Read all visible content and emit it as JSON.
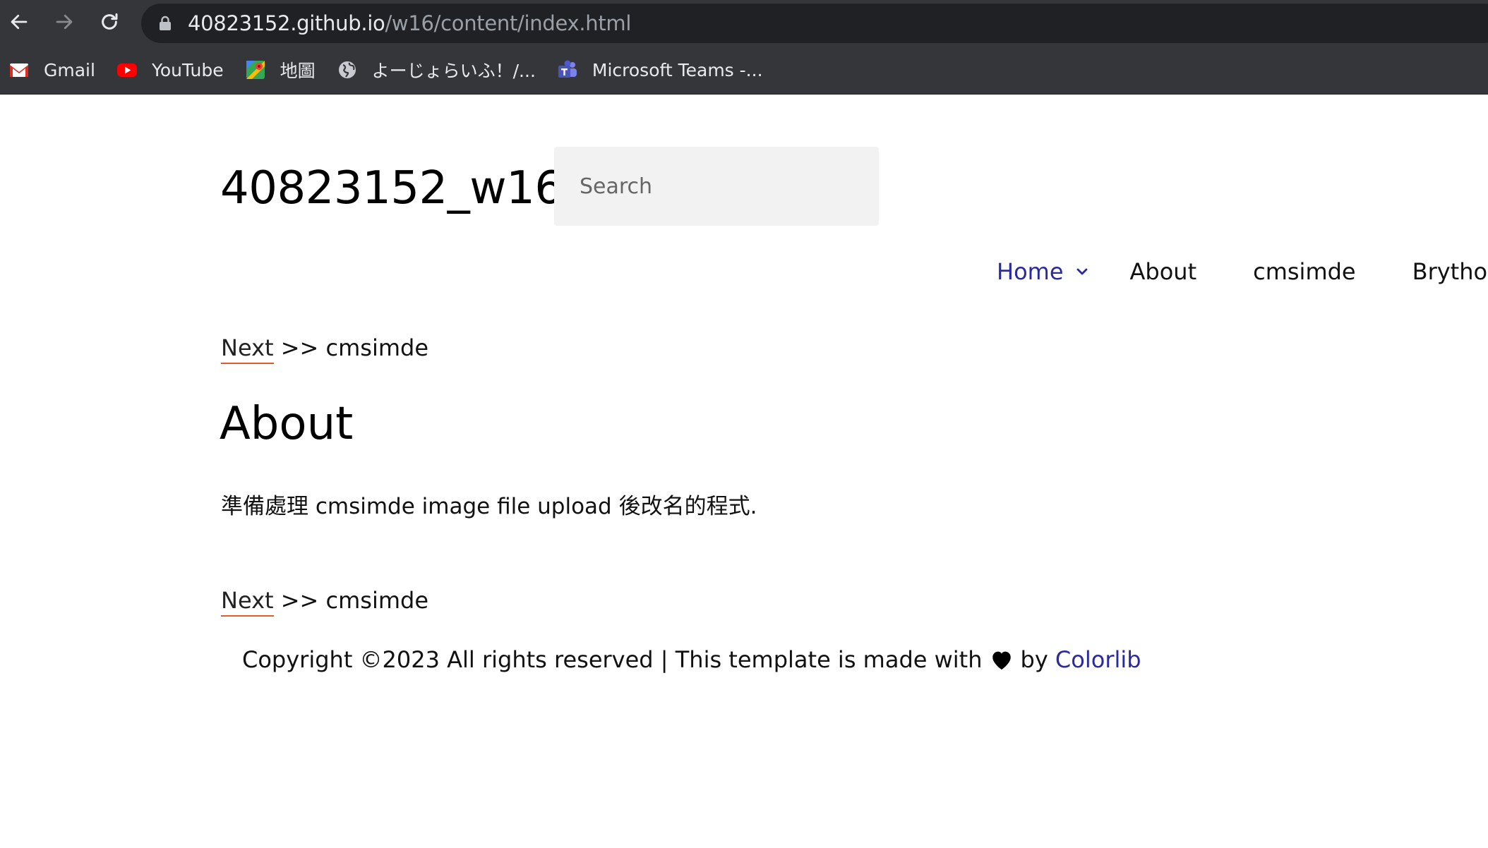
{
  "browser": {
    "url_host": "40823152.github.io",
    "url_path": "/w16/content/index.html",
    "bookmarks": [
      {
        "label": "Gmail",
        "icon": "gmail-icon"
      },
      {
        "label": "YouTube",
        "icon": "youtube-icon"
      },
      {
        "label": "地圖",
        "icon": "maps-icon"
      },
      {
        "label": "よーじょらいふ！/...",
        "icon": "globe-icon"
      },
      {
        "label": "Microsoft Teams -...",
        "icon": "teams-icon"
      }
    ]
  },
  "site": {
    "title": "40823152_w16",
    "search_placeholder": "Search"
  },
  "menu": {
    "items": [
      {
        "label": "Home",
        "active": true
      },
      {
        "label": "About",
        "active": false
      },
      {
        "label": "cmsimde",
        "active": false
      },
      {
        "label": "Brython",
        "active": false
      }
    ]
  },
  "content": {
    "next_label": "Next",
    "next_separator": " >> ",
    "next_target": "cmsimde",
    "heading": "About",
    "body": "準備處理 cmsimde image file upload 後改名的程式."
  },
  "footer": {
    "text_before": "Copyright ©2023 All rights reserved | This template is made with",
    "text_by": "by",
    "link": "Colorlib"
  },
  "colors": {
    "accent": "#2a2a9f",
    "link_underline": "#e65a28",
    "chrome_bg": "#35363a",
    "omnibox_bg": "#202124"
  }
}
